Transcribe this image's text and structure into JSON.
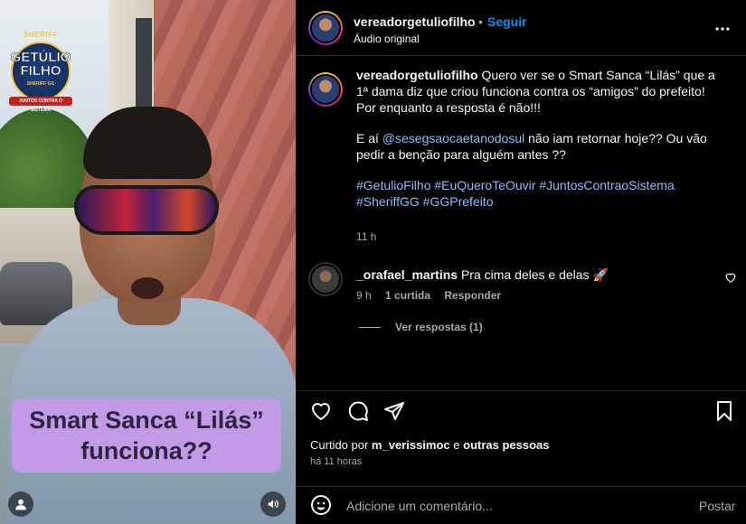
{
  "video": {
    "logo": {
      "top": "SHERIFF",
      "name_line1": "GETÚLIO",
      "name_line2": "FILHO",
      "sub": "SHERIFF GG",
      "tag": "JUNTOS CONTRA O SISTEMA"
    },
    "caption_line1": "Smart Sanca “Lilás”",
    "caption_line2": "funciona??",
    "caption_bg": "#c29ae8",
    "icons": {
      "user": "user-icon",
      "sound": "volume-icon"
    }
  },
  "post": {
    "username": "vereadorgetuliofilho",
    "dot": "•",
    "follow": "Seguir",
    "audio": "Áudio original",
    "more_icon": "more-horizontal-icon",
    "caption": {
      "username": "vereadorgetuliofilho",
      "text1": " Quero ver se o Smart Sanca “Lilás” que a 1ª dama diz que criou funciona contra os “amigos” do prefeito! Por enquanto a resposta é não!!!",
      "p2_before": "E aí ",
      "mention": "@sesegsaocaetanodosul",
      "p2_after": " não iam retornar hoje?? Ou vão pedir a benção para alguém antes ??",
      "hashtags": [
        "#GetulioFilho",
        "#EuQueroTeOuvir",
        "#JuntosContraoSistema",
        "#SheriffGG",
        "#GGPrefeito"
      ],
      "time": "11 h"
    },
    "comment": {
      "username": "_orafael_martins",
      "text": " Pra cima deles e delas 🚀",
      "time": "9 h",
      "likes": "1 curtida",
      "reply": "Responder",
      "view_replies": "Ver respostas (1)"
    },
    "actions": {
      "like_icon": "heart-icon",
      "comment_icon": "comment-icon",
      "share_icon": "send-icon",
      "save_icon": "bookmark-icon"
    },
    "liked_by_prefix": "Curtido por ",
    "liked_by_user": "m_verissimoc",
    "liked_by_mid": " e ",
    "liked_by_others": "outras pessoas",
    "posted_ago": "há 11 horas",
    "comment_bar": {
      "placeholder": "Adicione um comentário...",
      "post_label": "Postar",
      "emoji_icon": "emoji-icon"
    }
  }
}
